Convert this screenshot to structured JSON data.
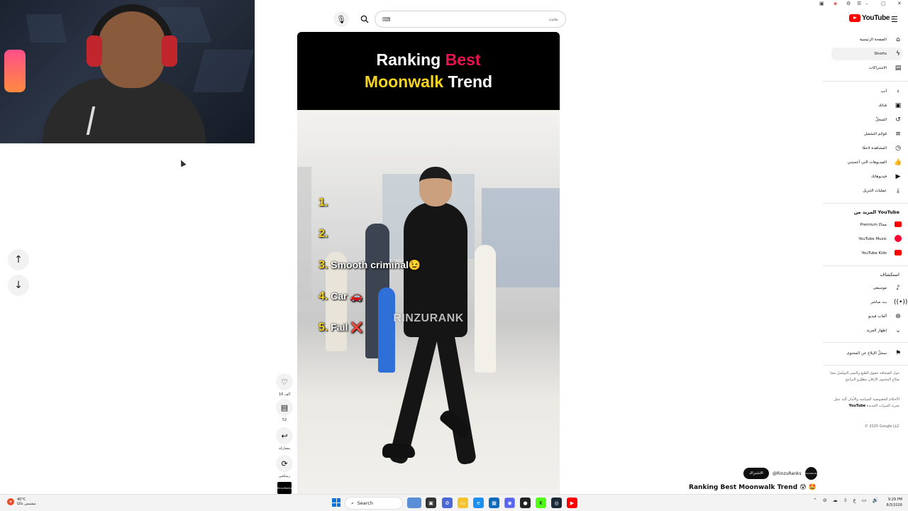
{
  "search": {
    "placeholder": "بحث",
    "keyboard_label": "⌨"
  },
  "short": {
    "title_line1_a": "Ranking",
    "title_line1_b": "Best",
    "title_line2_a": "Moonwalk",
    "title_line2_b": "Trend",
    "ranks": [
      {
        "num": "1.",
        "label": ""
      },
      {
        "num": "2.",
        "label": ""
      },
      {
        "num": "3.",
        "label": "Smooth criminal😉"
      },
      {
        "num": "4.",
        "label": "Car 🚗"
      },
      {
        "num": "5.",
        "label": "Fail ❌"
      }
    ],
    "watermark": "RINZURANK"
  },
  "actions": {
    "like_count": "16 ألف",
    "comment_count": "52",
    "share_label": "مشاركة",
    "remix_label": "ريمكس",
    "channel_avatar_text": "RinzuRanks"
  },
  "video_info": {
    "subscribe_label": "الاشتراك",
    "channel_handle": "@RinzuRanks",
    "title": "Ranking Best Moonwalk Trend 😰 🤩",
    "channel_icon_text": "RinzuRanks"
  },
  "sidebar": {
    "logo_text": "YouTube",
    "logo_sup": "SA",
    "main": [
      {
        "label": "الصفحة الرئيسية",
        "icon": "home-icon"
      },
      {
        "label": "Shorts",
        "icon": "shorts-icon"
      },
      {
        "label": "الاشتراكات",
        "icon": "subscriptions-icon"
      }
    ],
    "you_header": "أنت",
    "you": [
      {
        "label": "قناتك"
      },
      {
        "label": "السجلّ"
      },
      {
        "label": "قوائم التشغيل"
      },
      {
        "label": "المشاهدة لاحقًا"
      },
      {
        "label": "الفيديوهات التي أعجبتني"
      },
      {
        "label": "فيديوهاتك"
      },
      {
        "label": "عمليات التنزيل"
      }
    ],
    "more_header_prefix": "المزيد من",
    "more_header_brand": "YouTube",
    "more": [
      {
        "label": "Premium مجانًا"
      },
      {
        "label": "YouTube Music"
      },
      {
        "label": "YouTube Kids"
      }
    ],
    "explore_header": "استكشاف",
    "explore": [
      {
        "label": "موسيقى"
      },
      {
        "label": "بث مباشر"
      },
      {
        "label": "ألعاب فيديو"
      },
      {
        "label": "إظهار المزيد"
      }
    ],
    "report": "سجلّ الإبلاغ عن المحتوى",
    "footer1": "حول  الصحافة  حقوق الطبع والنشر  التواصل معنا  صنّاع المحتوى  الإعلان  مطوّرو البرامج",
    "footer2_a": "الأحكام  الخصوصية  السياسة والأمان  آلية عمل",
    "footer2_brand": "YouTube",
    "footer2_b": "تجربة الميزات الجديدة",
    "copyright": "© 2025 Google LLC"
  },
  "taskbar": {
    "weather_temp": "40°C",
    "weather_desc": "مشمس غالبًا",
    "search_label": "Search",
    "time": "9:29 PM",
    "date": "8/3/2026",
    "lang": "ع"
  },
  "colors": {
    "brand_red": "#ff0000",
    "title_pink": "#e8134c",
    "title_yellow": "#f7d41e"
  }
}
